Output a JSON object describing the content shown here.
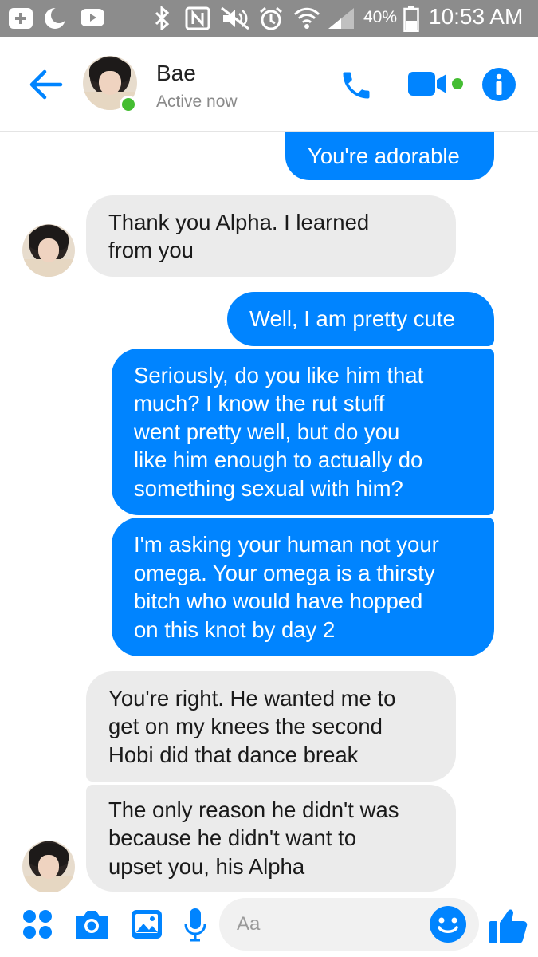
{
  "status_bar": {
    "battery": "40%",
    "time": "10:53 AM",
    "icons": [
      "plus-box-icon",
      "moon-icon",
      "youtube-icon",
      "bluetooth-icon",
      "nfc-icon",
      "mute-icon",
      "alarm-icon",
      "wifi-icon",
      "signal-icon",
      "battery-icon"
    ]
  },
  "header": {
    "contact_name": "Bae",
    "contact_status": "Active now",
    "icons": [
      "back-arrow-icon",
      "phone-icon",
      "video-camera-icon",
      "info-icon"
    ]
  },
  "messages": [
    {
      "direction": "sent",
      "lines": [
        "You're adorable"
      ]
    },
    {
      "direction": "received",
      "lines": [
        "Thank you Alpha. I learned",
        "from you"
      ]
    },
    {
      "direction": "sent",
      "lines": [
        "Well, I am pretty cute"
      ]
    },
    {
      "direction": "sent",
      "lines": [
        "Seriously, do you like him that",
        "much? I know the rut stuff",
        "went pretty well, but do you",
        "like him enough to actually do",
        "something sexual with him?"
      ]
    },
    {
      "direction": "sent",
      "lines": [
        "I'm asking your human not your",
        "omega. Your omega is a thirsty",
        "bitch who would have hopped",
        "on this knot by day 2"
      ]
    },
    {
      "direction": "received",
      "lines": [
        "You're right. He wanted me to",
        "get on my knees the second",
        "Hobi did that dance break"
      ]
    },
    {
      "direction": "received",
      "lines": [
        "The only reason he didn't was",
        "because he didn't want to",
        "upset you, his Alpha"
      ]
    }
  ],
  "composer": {
    "placeholder": "Aa",
    "icons": [
      "apps-grid-icon",
      "camera-icon",
      "gallery-icon",
      "microphone-icon",
      "emoji-icon",
      "thumbs-up-icon"
    ]
  },
  "colors": {
    "accent": "#0084ff",
    "sent_bubble": "#0084ff",
    "received_bubble": "#ebebeb",
    "online": "#44bd32",
    "status_bar": "#8c8c8c"
  }
}
